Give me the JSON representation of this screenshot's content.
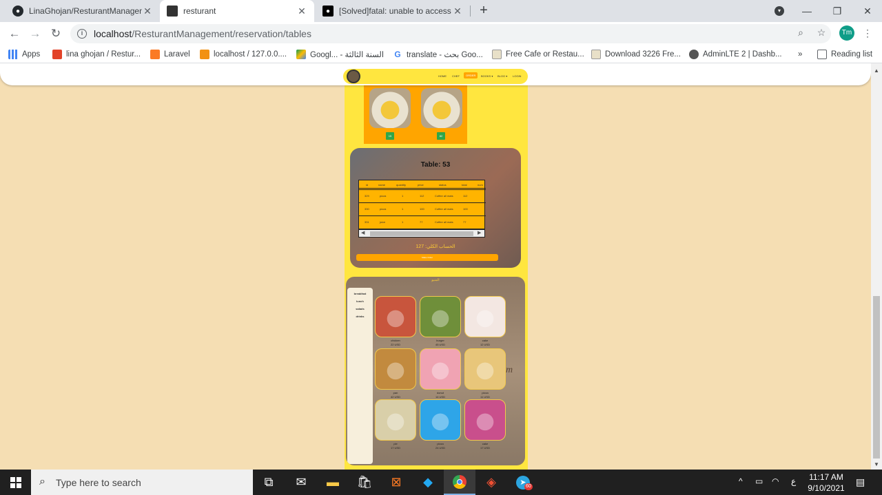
{
  "browser": {
    "tabs": [
      {
        "title": "LinaGhojan/ResturantManageme",
        "icon": "github-icon",
        "active": false
      },
      {
        "title": "resturant",
        "icon": "site-favicon",
        "active": true
      },
      {
        "title": "[Solved]fatal: unable to access : C",
        "icon": "medium-icon",
        "active": false
      }
    ],
    "address": {
      "host": "localhost",
      "path": "/ResturantManagement/reservation/tables"
    },
    "profile_initials": "Tm",
    "bookmarks": [
      {
        "label": "Apps",
        "icon": "apps-grid-icon"
      },
      {
        "label": "lina ghojan / Restur...",
        "icon": "gitlab-icon"
      },
      {
        "label": "Laravel",
        "icon": "xampp-icon"
      },
      {
        "label": "localhost / 127.0.0....",
        "icon": "phpmyadmin-icon"
      },
      {
        "label": "Googl... - السنة الثالثة",
        "icon": "google-drive-icon"
      },
      {
        "label": "translate - بحث Goo...",
        "icon": "google-icon"
      },
      {
        "label": "Free Cafe or Restau...",
        "icon": "image-icon"
      },
      {
        "label": "Download 3226 Fre...",
        "icon": "image-icon"
      },
      {
        "label": "AdminLTE 2 | Dashb...",
        "icon": "globe-icon"
      },
      {
        "label": "»",
        "icon": "chevron-icon"
      },
      {
        "label": "Reading list",
        "icon": "reading-list-icon"
      }
    ]
  },
  "site": {
    "nav": [
      "HOME",
      "CHEF",
      "ORDER",
      "BOOKS ▾",
      "BLOG ▾",
      "LOGIN"
    ],
    "dish_badges": [
      "15",
      "82"
    ],
    "table_card": {
      "title": "Table: 53",
      "columns": [
        "id",
        "name",
        "quantity",
        "price",
        "status",
        "total",
        "num"
      ],
      "rows": [
        [
          "329",
          "pizza",
          "1",
          "112",
          "Coffee all mats",
          "112",
          ""
        ],
        [
          "330",
          "pizza",
          "1",
          "100",
          "Coffee all mats",
          "100",
          ""
        ],
        [
          "331",
          "juice",
          "1",
          "77",
          "Coffee all mats",
          "77",
          ""
        ]
      ],
      "arabic_total": "الحساب الكلي: 127",
      "button_label": "Make Order"
    },
    "menu": {
      "title": "المنيو",
      "categories": [
        "breakfast",
        "lunch",
        "salads",
        "drinks"
      ],
      "items": [
        {
          "name": "chicken",
          "price": "22 USD",
          "color": "#c8553d"
        },
        {
          "name": "burger",
          "price": "45 USD",
          "color": "#6f8f3a"
        },
        {
          "name": "cake",
          "price": "12 USD",
          "color": "#f3e7e2"
        },
        {
          "name": "pan",
          "price": "42 USD",
          "color": "#c28a3e"
        },
        {
          "name": "donut",
          "price": "14 USD",
          "color": "#f0a3b3"
        },
        {
          "name": "pizza",
          "price": "11 USD",
          "color": "#e8c67a"
        },
        {
          "name": "pie",
          "price": "17 USD",
          "color": "#d9cfa9"
        },
        {
          "name": "pizza",
          "price": "24 USD",
          "color": "#2ea5e8"
        },
        {
          "name": "cake",
          "price": "17 USD",
          "color": "#c94f8c"
        }
      ],
      "deco_text": "m"
    }
  },
  "taskbar": {
    "search_placeholder": "Type here to search",
    "time": "11:17 AM",
    "date": "9/10/2021",
    "lang": "ع",
    "telegram_badge": "60"
  },
  "colors": {
    "page_bg": "#f5deb3",
    "site_yellow": "#ffe63f",
    "site_orange": "#ffa500"
  }
}
